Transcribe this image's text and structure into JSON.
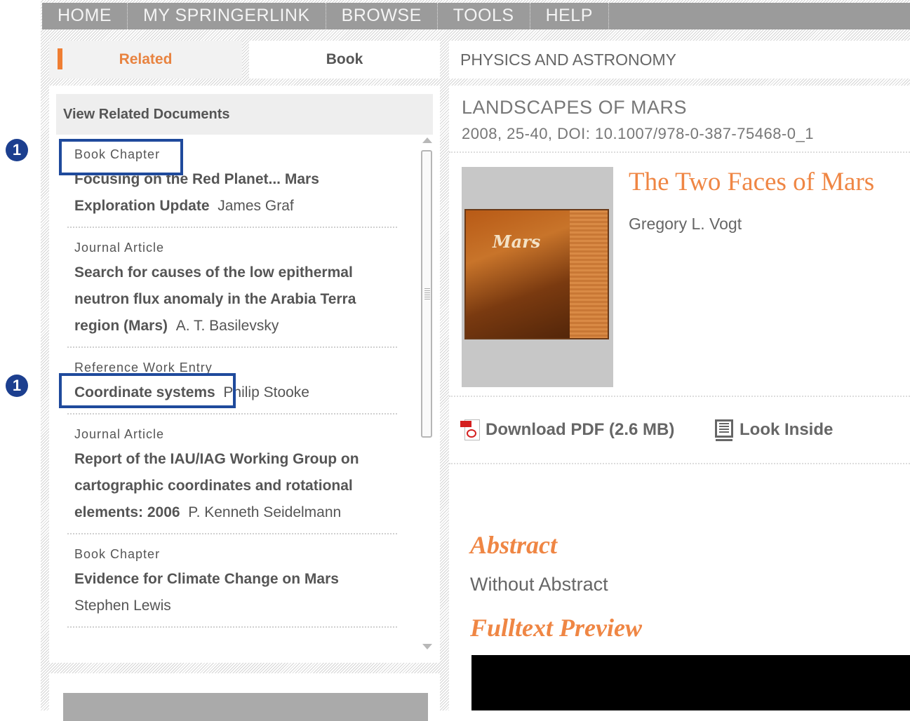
{
  "nav": {
    "items": [
      "HOME",
      "MY SPRINGERLINK",
      "BROWSE",
      "TOOLS",
      "HELP"
    ]
  },
  "tabs": {
    "related": "Related",
    "book": "Book"
  },
  "subject": "PHYSICS AND ASTRONOMY",
  "related_panel": {
    "header": "View Related Documents",
    "items": [
      {
        "type": "Book Chapter",
        "title": "Focusing on the Red Planet... Mars Exploration Update",
        "author": "James Graf"
      },
      {
        "type": "Journal Article",
        "title": "Search for causes of the low epithermal neutron flux anomaly in the Arabia Terra region (Mars)",
        "author": "A. T. Basilevsky"
      },
      {
        "type": "Reference Work Entry",
        "title": "Coordinate systems",
        "author": "Philip Stooke"
      },
      {
        "type": "Journal Article",
        "title": "Report of the IAU/IAG Working Group on cartographic coordinates and rotational elements: 2006",
        "author": "P. Kenneth Seidelmann"
      },
      {
        "type": "Book Chapter",
        "title": "Evidence for Climate Change on Mars",
        "author": "Stephen Lewis"
      }
    ]
  },
  "content": {
    "series_title": "LANDSCAPES OF MARS",
    "series_meta": "2008, 25-40, DOI: 10.1007/978-0-387-75468-0_1",
    "cover_text": "Mars",
    "chapter_title": "The Two Faces of Mars",
    "chapter_author": "Gregory L. Vogt",
    "download_label": "Download PDF (2.6 MB)",
    "look_inside_label": "Look Inside",
    "abstract_heading": "Abstract",
    "abstract_text": "Without Abstract",
    "fulltext_heading": "Fulltext Preview"
  },
  "annotations": {
    "callout_1": "1",
    "callout_2": "1"
  },
  "colors": {
    "accent": "#ef8644",
    "nav_bg": "#9b9b9b",
    "callout": "#1c3f8f"
  }
}
